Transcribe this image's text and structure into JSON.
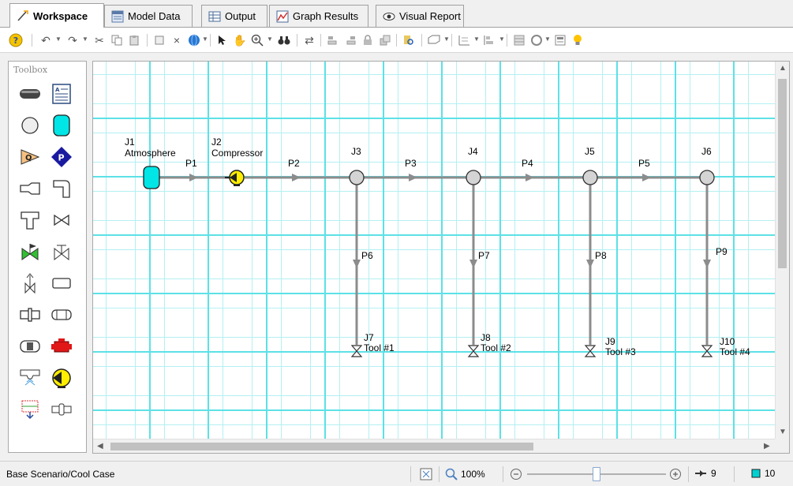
{
  "tabs": [
    {
      "label": "Workspace",
      "icon": "workspace-icon"
    },
    {
      "label": "Model Data",
      "icon": "model-data-icon"
    },
    {
      "label": "Output",
      "icon": "output-table-icon"
    },
    {
      "label": "Graph Results",
      "icon": "graph-icon"
    },
    {
      "label": "Visual Report",
      "icon": "eye-icon"
    }
  ],
  "toolbox": {
    "title": "Toolbox"
  },
  "nodes": [
    {
      "id": "J1",
      "label": "J1",
      "name": "Atmosphere",
      "type": "tank"
    },
    {
      "id": "J2",
      "label": "J2",
      "name": "Compressor",
      "type": "compressor"
    },
    {
      "id": "J3",
      "label": "J3",
      "name": "",
      "type": "branch"
    },
    {
      "id": "J4",
      "label": "J4",
      "name": "",
      "type": "branch"
    },
    {
      "id": "J5",
      "label": "J5",
      "name": "",
      "type": "branch"
    },
    {
      "id": "J6",
      "label": "J6",
      "name": "",
      "type": "branch"
    },
    {
      "id": "J7",
      "label": "J7",
      "name": "Tool #1",
      "type": "valve"
    },
    {
      "id": "J8",
      "label": "J8",
      "name": "Tool #2",
      "type": "valve"
    },
    {
      "id": "J9",
      "label": "J9",
      "name": "Tool #3",
      "type": "valve"
    },
    {
      "id": "J10",
      "label": "J10",
      "name": "Tool #4",
      "type": "valve"
    }
  ],
  "pipes": [
    {
      "label": "P1"
    },
    {
      "label": "P2"
    },
    {
      "label": "P3"
    },
    {
      "label": "P4"
    },
    {
      "label": "P5"
    },
    {
      "label": "P6"
    },
    {
      "label": "P7"
    },
    {
      "label": "P8"
    },
    {
      "label": "P9"
    }
  ],
  "status": {
    "scenario": "Base Scenario/Cool Case",
    "zoom": "100%",
    "pipe_count": "9",
    "junction_count": "10"
  },
  "colors": {
    "grid_major": "#5ce1e6",
    "grid_minor": "#b3f0f2",
    "pipe": "#8c8c8c",
    "tank": "#00e5e5",
    "compressor": "#ffee00",
    "junction": "#d4d4d4"
  }
}
